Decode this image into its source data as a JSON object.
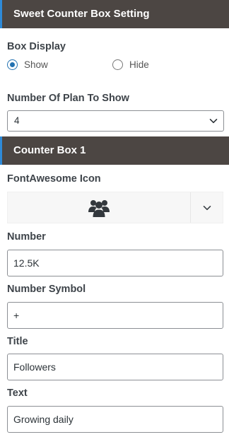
{
  "settings": {
    "header": "Sweet Counter Box Setting",
    "box_display_label": "Box Display",
    "show_label": "Show",
    "hide_label": "Hide",
    "box_display_selected": "Show",
    "plan_count_label": "Number Of Plan To Show",
    "plan_count_value": "4"
  },
  "counter_box": {
    "header": "Counter Box 1",
    "icon_label": "FontAwesome Icon",
    "icon_name": "users-icon",
    "number_label": "Number",
    "number_value": "12.5K",
    "symbol_label": "Number Symbol",
    "symbol_value": "+",
    "title_label": "Title",
    "title_value": "Followers",
    "text_label": "Text",
    "text_value": "Growing daily"
  },
  "colors": {
    "header_bg": "#4c4643",
    "accent": "#2e8ad8",
    "radio_selected": "#2271b1"
  }
}
